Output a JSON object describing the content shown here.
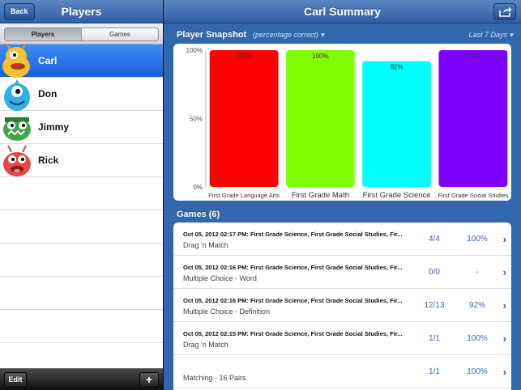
{
  "left": {
    "title": "Players",
    "back_label": "Back",
    "tabs": [
      "Players",
      "Games"
    ],
    "players": [
      {
        "name": "Carl",
        "color": "#f2c230",
        "selected": true
      },
      {
        "name": "Don",
        "color": "#2fb1e6",
        "selected": false
      },
      {
        "name": "Jimmy",
        "color": "#39a845",
        "selected": false
      },
      {
        "name": "Rick",
        "color": "#e24848",
        "selected": false
      }
    ],
    "edit_label": "Edit",
    "add_label": "+"
  },
  "right": {
    "title": "Carl Summary",
    "snapshot_title": "Player Snapshot",
    "snapshot_subtitle": "(percentage correct) ▾",
    "range_label": "Last 7 Days ▾",
    "games_title": "Games (6)",
    "games": [
      {
        "date": "Oct 05, 2012  02:17 PM: First Grade Science, First Grade Social Studies, Fir...",
        "type": "Drag 'n Match",
        "score": "4/4",
        "pct": "100%"
      },
      {
        "date": "Oct 05, 2012  02:16 PM: First Grade Science, First Grade Social Studies, Fir...",
        "type": "Multiple Choice - Word",
        "score": "0/0",
        "pct": "-"
      },
      {
        "date": "Oct 05, 2012  02:16 PM: First Grade Science, First Grade Social Studies, Fir...",
        "type": "Multiple Choice - Definition",
        "score": "12/13",
        "pct": "92%"
      },
      {
        "date": "Oct 05, 2012  02:15 PM: First Grade Science, First Grade Social Studies, Fir...",
        "type": "Drag 'n Match",
        "score": "1/1",
        "pct": "100%"
      },
      {
        "date": "",
        "type": "Matching - 16 Pairs",
        "score": "1/1",
        "pct": "100%"
      }
    ]
  },
  "chart_data": {
    "type": "bar",
    "categories": [
      "First Grade Language Arts",
      "First Grade Math",
      "First Grade Science",
      "First Grade Social Studies"
    ],
    "values": [
      100,
      100,
      92,
      100
    ],
    "value_labels": [
      "100%",
      "100%",
      "92%",
      "100%"
    ],
    "colors": [
      "#ff0000",
      "#80ff00",
      "#00ffff",
      "#8000ff"
    ],
    "yticks": [
      "100%",
      "50%",
      "0%"
    ],
    "ylim": [
      0,
      100
    ]
  }
}
